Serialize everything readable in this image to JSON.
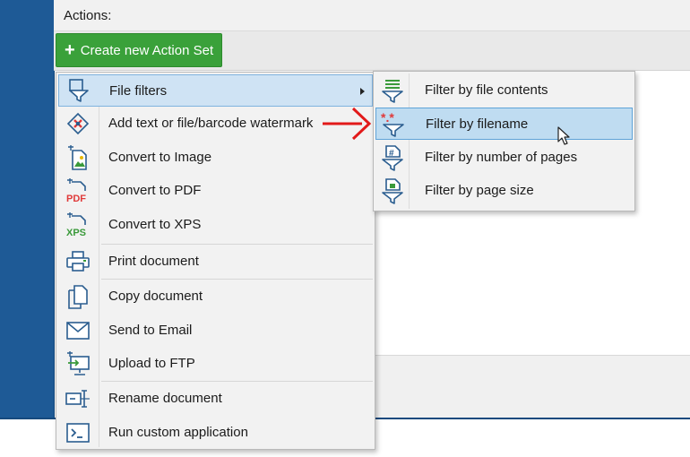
{
  "header": {
    "actions_label": "Actions:"
  },
  "toolbar": {
    "create_label": "Create new Action Set"
  },
  "menu": {
    "items": [
      {
        "label": "File filters",
        "icon": "file-filters-icon",
        "has_submenu": true
      },
      {
        "label": "Add text or file/barcode watermark",
        "icon": "watermark-icon"
      },
      {
        "label": "Convert to Image",
        "icon": "convert-image-icon"
      },
      {
        "label": "Convert to PDF",
        "icon": "convert-pdf-icon"
      },
      {
        "label": "Convert to XPS",
        "icon": "convert-xps-icon"
      },
      {
        "label": "Print document",
        "icon": "printer-icon"
      },
      {
        "label": "Copy document",
        "icon": "copy-document-icon"
      },
      {
        "label": "Send to Email",
        "icon": "email-icon"
      },
      {
        "label": "Upload to FTP",
        "icon": "ftp-upload-icon"
      },
      {
        "label": "Rename document",
        "icon": "rename-icon"
      },
      {
        "label": "Run custom application",
        "icon": "terminal-icon"
      }
    ]
  },
  "submenu": {
    "items": [
      {
        "label": "Filter by file contents",
        "icon": "filter-contents-icon"
      },
      {
        "label": "Filter by filename",
        "icon": "filter-filename-icon"
      },
      {
        "label": "Filter by number of pages",
        "icon": "filter-pages-icon"
      },
      {
        "label": "Filter by page size",
        "icon": "filter-page-size-icon"
      }
    ]
  },
  "icon_glyphs": {
    "pdf": "PDF",
    "xps": "XPS",
    "wildcard": "*.*",
    "hash": "#"
  },
  "colors": {
    "brand_blue": "#1e5a96",
    "button_green": "#3aa13a",
    "highlight": "#cfe3f4",
    "highlight_sub": "#bfdcf1",
    "icon_blue": "#2a5d8f",
    "icon_red": "#e03a3a",
    "icon_green": "#3a9a3a",
    "arrow_red": "#e21a1a"
  }
}
